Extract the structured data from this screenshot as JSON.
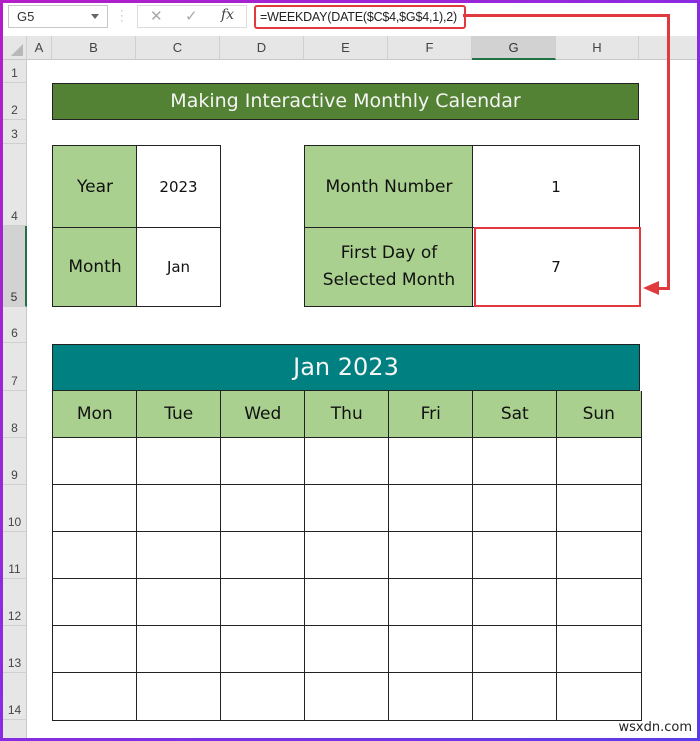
{
  "formula_bar": {
    "name_box": "G5",
    "cancel_icon": "✕",
    "enter_icon": "✓",
    "fx_label": "fx",
    "formula": "=WEEKDAY(DATE($C$4,$G$4,1),2)"
  },
  "columns": [
    "A",
    "B",
    "C",
    "D",
    "E",
    "F",
    "G",
    "H"
  ],
  "selected_column": "G",
  "rows": [
    "1",
    "2",
    "3",
    "4",
    "5",
    "6",
    "7",
    "8",
    "9",
    "10",
    "11",
    "12",
    "13",
    "14"
  ],
  "selected_row": "5",
  "title": "Making Interactive Monthly Calendar",
  "inputs": {
    "year_label": "Year",
    "year_value": "2023",
    "month_label": "Month",
    "month_value": "Jan"
  },
  "outputs": {
    "month_number_label": "Month Number",
    "month_number_value": "1",
    "first_day_label": "First Day of Selected Month",
    "first_day_value": "7"
  },
  "calendar": {
    "header": "Jan 2023",
    "days": [
      "Mon",
      "Tue",
      "Wed",
      "Thu",
      "Fri",
      "Sat",
      "Sun"
    ],
    "weeks": [
      [
        "",
        "",
        "",
        "",
        "",
        "",
        ""
      ],
      [
        "",
        "",
        "",
        "",
        "",
        "",
        ""
      ],
      [
        "",
        "",
        "",
        "",
        "",
        "",
        ""
      ],
      [
        "",
        "",
        "",
        "",
        "",
        "",
        ""
      ],
      [
        "",
        "",
        "",
        "",
        "",
        "",
        ""
      ],
      [
        "",
        "",
        "",
        "",
        "",
        "",
        ""
      ]
    ]
  },
  "colors": {
    "title_bg": "#548235",
    "label_bg": "#a9d08e",
    "calendar_header_bg": "#008080",
    "highlight": "#e0393e",
    "selection_accent": "#217346"
  },
  "watermark": "wsxdn.com"
}
